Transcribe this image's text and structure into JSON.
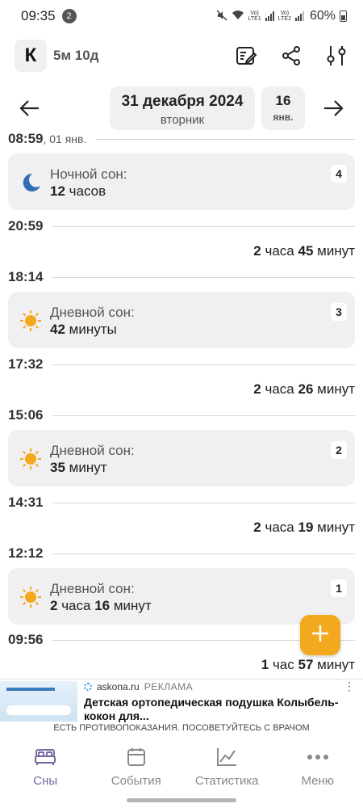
{
  "status_bar": {
    "time": "09:35",
    "notif_count": "2",
    "sim1": "LTE1",
    "sim2": "LTE2",
    "battery": "60%"
  },
  "header": {
    "avatar_letter": "К",
    "age": "5м 10д"
  },
  "date_nav": {
    "date": "31 декабря 2024",
    "weekday": "вторник",
    "today_day": "16",
    "today_month": "янв."
  },
  "timeline": {
    "t0": {
      "time": "08:59",
      "date": ", 01 янв."
    },
    "card4": {
      "title": "Ночной сон:",
      "value_num": "12",
      "value_unit": " часов",
      "index": "4"
    },
    "t1": {
      "time": "20:59"
    },
    "gap1": {
      "h": "2",
      "h_unit": " часа ",
      "m": "45",
      "m_unit": " минут"
    },
    "t2": {
      "time": "18:14"
    },
    "card3": {
      "title": "Дневной сон:",
      "value_num": "42",
      "value_unit": " минуты",
      "index": "3"
    },
    "t3": {
      "time": "17:32"
    },
    "gap2": {
      "h": "2",
      "h_unit": " часа ",
      "m": "26",
      "m_unit": " минут"
    },
    "t4": {
      "time": "15:06"
    },
    "card2": {
      "title": "Дневной сон:",
      "value_num": "35",
      "value_unit": " минут",
      "index": "2"
    },
    "t5": {
      "time": "14:31"
    },
    "gap3": {
      "h": "2",
      "h_unit": " часа ",
      "m": "19",
      "m_unit": " минут"
    },
    "t6": {
      "time": "12:12"
    },
    "card1": {
      "title": "Дневной сон:",
      "h": "2",
      "h_unit": " часа ",
      "m": "16",
      "m_unit": " минут",
      "index": "1"
    },
    "t7": {
      "time": "09:56"
    },
    "gap4": {
      "h": "1",
      "h_unit": " час ",
      "m": "57",
      "m_unit": " минут"
    }
  },
  "fab": {
    "icon": "plus-icon"
  },
  "ad": {
    "source": "askona.ru",
    "label": "РЕКЛАМА",
    "title": "Детская ортопедическая подушка Колыбель-кокон для...",
    "warning": "ЕСТЬ ПРОТИВОПОКАЗАНИЯ. ПОСОВЕТУЙТЕСЬ С ВРАЧОМ"
  },
  "bottom_nav": {
    "sleep": "Сны",
    "events": "События",
    "stats": "Статистика",
    "menu": "Меню"
  },
  "colors": {
    "accent": "#f3a91d",
    "active_nav": "#7a68a6",
    "moon": "#2f6db5",
    "sun": "#f3a91d",
    "card_bg": "#f0f0f2"
  }
}
